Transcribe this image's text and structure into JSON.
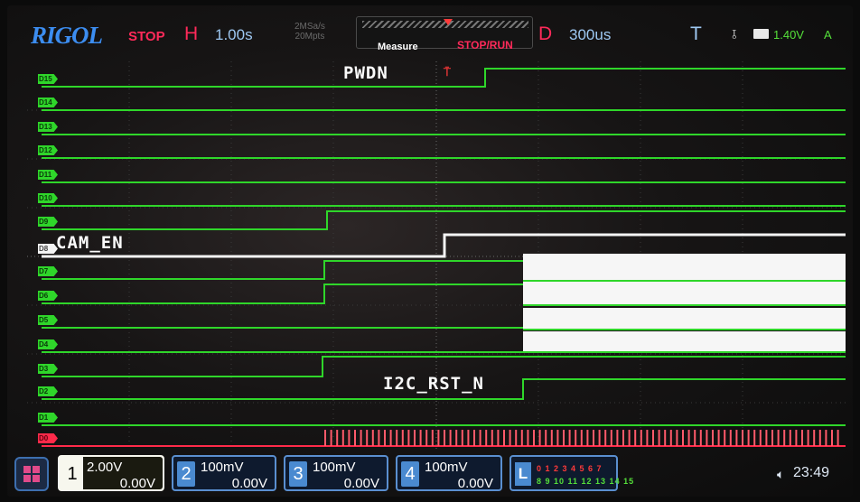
{
  "topbar": {
    "brand": "RIGOL",
    "run_state": "STOP",
    "horizontal_key": "H",
    "timebase": "1.00s",
    "sample_rate_line1": "2MSa/s",
    "sample_rate_line2": "20Mpts",
    "measure_label": "Measure",
    "stop_run_label": "STOP/RUN",
    "delay_key": "D",
    "delay_value": "300us",
    "trigger_key": "T",
    "trigger_level": "1.40V",
    "trigger_mode": "A"
  },
  "channels": {
    "digital": [
      "D15",
      "D14",
      "D13",
      "D12",
      "D11",
      "D10",
      "D9",
      "D8",
      "D7",
      "D6",
      "D5",
      "D4",
      "D3",
      "D2",
      "D1",
      "D0"
    ]
  },
  "annotations": {
    "pwdn": "PWDN",
    "cam_en": "CAM_EN",
    "i2c_rst_n": "I2C_RST_N"
  },
  "bottombar": {
    "analog": [
      {
        "num": "1",
        "scale": "2.00V",
        "offset": "0.00V"
      },
      {
        "num": "2",
        "scale": "100mV",
        "offset": "0.00V"
      },
      {
        "num": "3",
        "scale": "100mV",
        "offset": "0.00V"
      },
      {
        "num": "4",
        "scale": "100mV",
        "offset": "0.00V"
      }
    ],
    "la_letter": "L",
    "la_row1": "0 1 2 3 4 5 6 7",
    "la_row2": "8 9 10 11 12 13 14 15",
    "clock": "23:49"
  },
  "colors": {
    "trace_green": "#2fd62a",
    "trace_white": "#f4f4f4",
    "trace_red": "#ff2a4a",
    "accent_blue": "#4a8ad0",
    "brand_blue": "#3c8df0"
  }
}
